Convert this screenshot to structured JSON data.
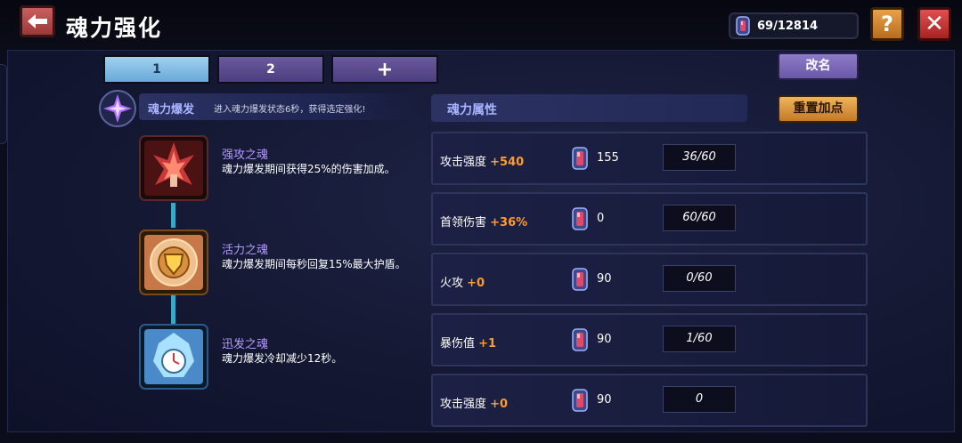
{
  "header": {
    "title": "魂力强化",
    "currency": "69/12814",
    "help_label": "?",
    "close_label": "✕"
  },
  "tabs": [
    {
      "label": "1",
      "active": true
    },
    {
      "label": "2"
    },
    {
      "label": "+"
    }
  ],
  "buttons": {
    "rename": "改名",
    "reset": "重置加点"
  },
  "burst": {
    "name": "魂力爆发",
    "description": "进入魂力爆发状态6秒，获得选定强化!"
  },
  "souls": [
    {
      "name": "强攻之魂",
      "description": "魂力爆发期间获得25%的伤害加成。",
      "icon": "attack-soul-icon"
    },
    {
      "name": "活力之魂",
      "description": "魂力爆发期间每秒回复15%最大护盾。",
      "icon": "vitality-soul-icon"
    },
    {
      "name": "迅发之魂",
      "description": "魂力爆发冷却减少12秒。",
      "icon": "swift-soul-icon"
    }
  ],
  "attributes": {
    "header": "魂力属性",
    "rows": [
      {
        "name": "攻击强度",
        "bonus": "+540",
        "cost": "155",
        "level": "36/60"
      },
      {
        "name": "首领伤害",
        "bonus": "+36%",
        "cost": "0",
        "level": "60/60"
      },
      {
        "name": "火攻",
        "bonus": "+0",
        "cost": "90",
        "level": "0/60"
      },
      {
        "name": "暴伤值",
        "bonus": "+1",
        "cost": "90",
        "level": "1/60"
      },
      {
        "name": "攻击强度",
        "bonus": "+0",
        "cost": "90",
        "level": "0"
      }
    ]
  },
  "colors": {
    "accent": "#ff9a2e",
    "soul_name": "#b49aff",
    "label_blue": "#a8b4ff"
  }
}
